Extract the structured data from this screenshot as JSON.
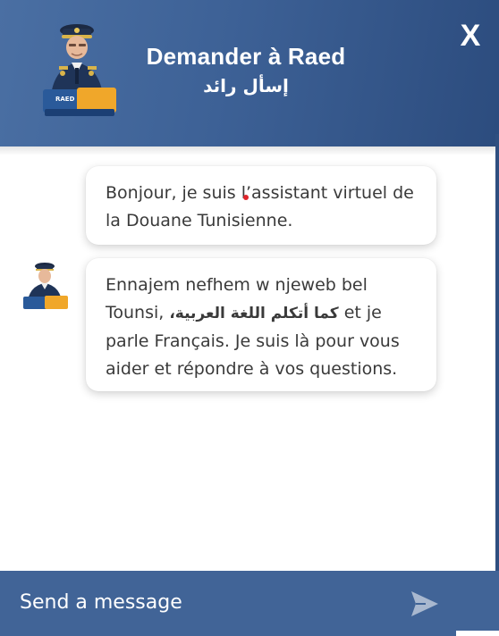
{
  "header": {
    "title": "Demander à Raed",
    "subtitle": "إسأل رائد",
    "close_label": "X",
    "avatar_icon": "customs-officer-avatar",
    "badge_text": "RAED"
  },
  "messages": [
    {
      "sender": "bot",
      "text": "Bonjour, je suis l’assistant virtuel de la Douane Tunisienne."
    },
    {
      "sender": "bot",
      "text_before": "Ennajem nefhem w njeweb bel Tounsi, ",
      "text_arabic": "كما أتكلم اللغة العربية،",
      "text_after": " et je parle Français. Je suis là pour vous aider et répondre à vos questions."
    }
  ],
  "composer": {
    "placeholder": "Send a message",
    "send_icon": "send-icon"
  },
  "colors": {
    "header_start": "#4a6fa3",
    "header_end": "#2c4c7e",
    "input_bar": "#416497",
    "bubble_text": "#3a3a3a"
  }
}
